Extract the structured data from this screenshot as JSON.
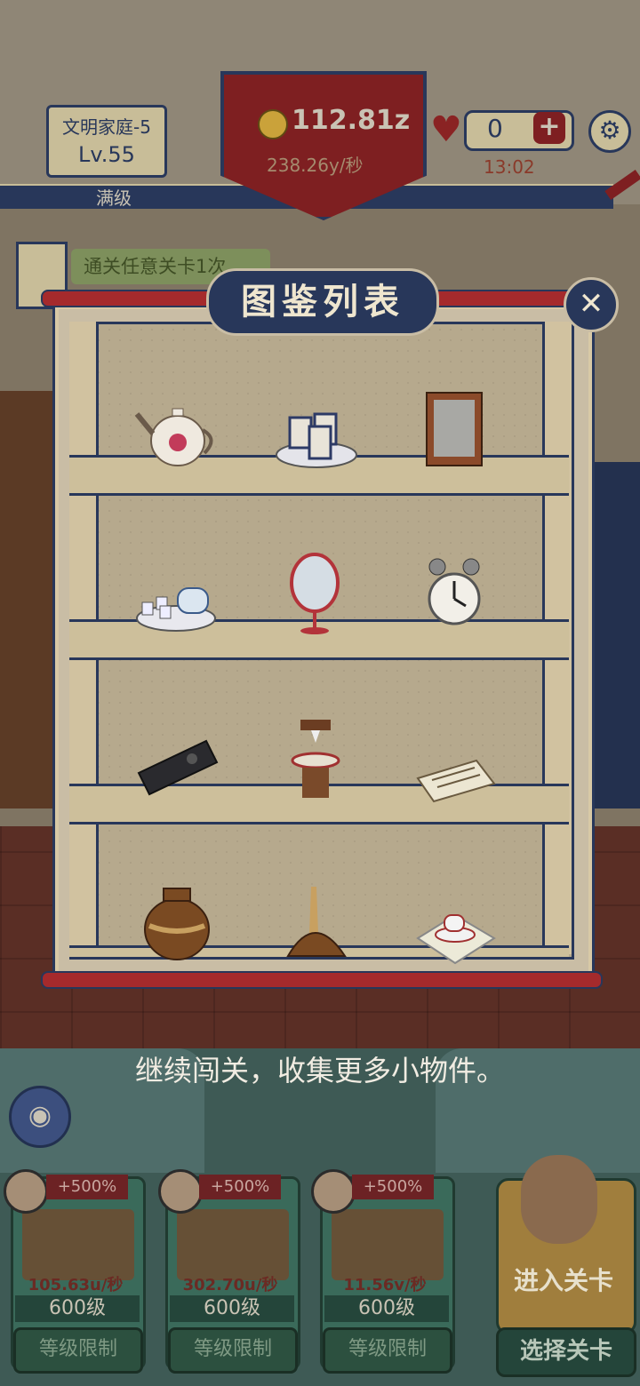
{
  "hud": {
    "family_name": "文明家庭-5",
    "family_level": "Lv.55",
    "max_level_label": "满级",
    "coins": "112.81z",
    "coin_rate": "238.26y/秒",
    "hearts": "0",
    "plus_label": "+",
    "timer": "13:02",
    "gear_icon": "⚙"
  },
  "task": {
    "text": "通关任意关卡1次"
  },
  "codex": {
    "title": "图鉴列表",
    "close_label": "✕",
    "items": [
      {
        "name": "teapot"
      },
      {
        "name": "fortune-cups"
      },
      {
        "name": "photo-frame"
      },
      {
        "name": "tea-set"
      },
      {
        "name": "vanity-mirror"
      },
      {
        "name": "alarm-clock"
      },
      {
        "name": "tv-remote"
      },
      {
        "name": "washbasin-stand"
      },
      {
        "name": "newspaper"
      },
      {
        "name": "clay-jar"
      },
      {
        "name": "feather-duster"
      },
      {
        "name": "tea-tray-cloth"
      }
    ]
  },
  "hint": "继续闯关，收集更多小物件。",
  "cards": [
    {
      "badge": "+500%",
      "rate": "105.63u/秒",
      "level": "600级",
      "button": "等级限制"
    },
    {
      "badge": "+500%",
      "rate": "302.70u/秒",
      "level": "600级",
      "button": "等级限制"
    },
    {
      "badge": "+500%",
      "rate": "11.56v/秒",
      "level": "600级",
      "button": "等级限制"
    }
  ],
  "actions": {
    "enter_level": "进入关卡",
    "select_level": "选择关卡"
  },
  "colors": {
    "navy": "#28375a",
    "red": "#a52a2c",
    "shelf": "#b6a98d",
    "green": "#3a6a5a"
  }
}
